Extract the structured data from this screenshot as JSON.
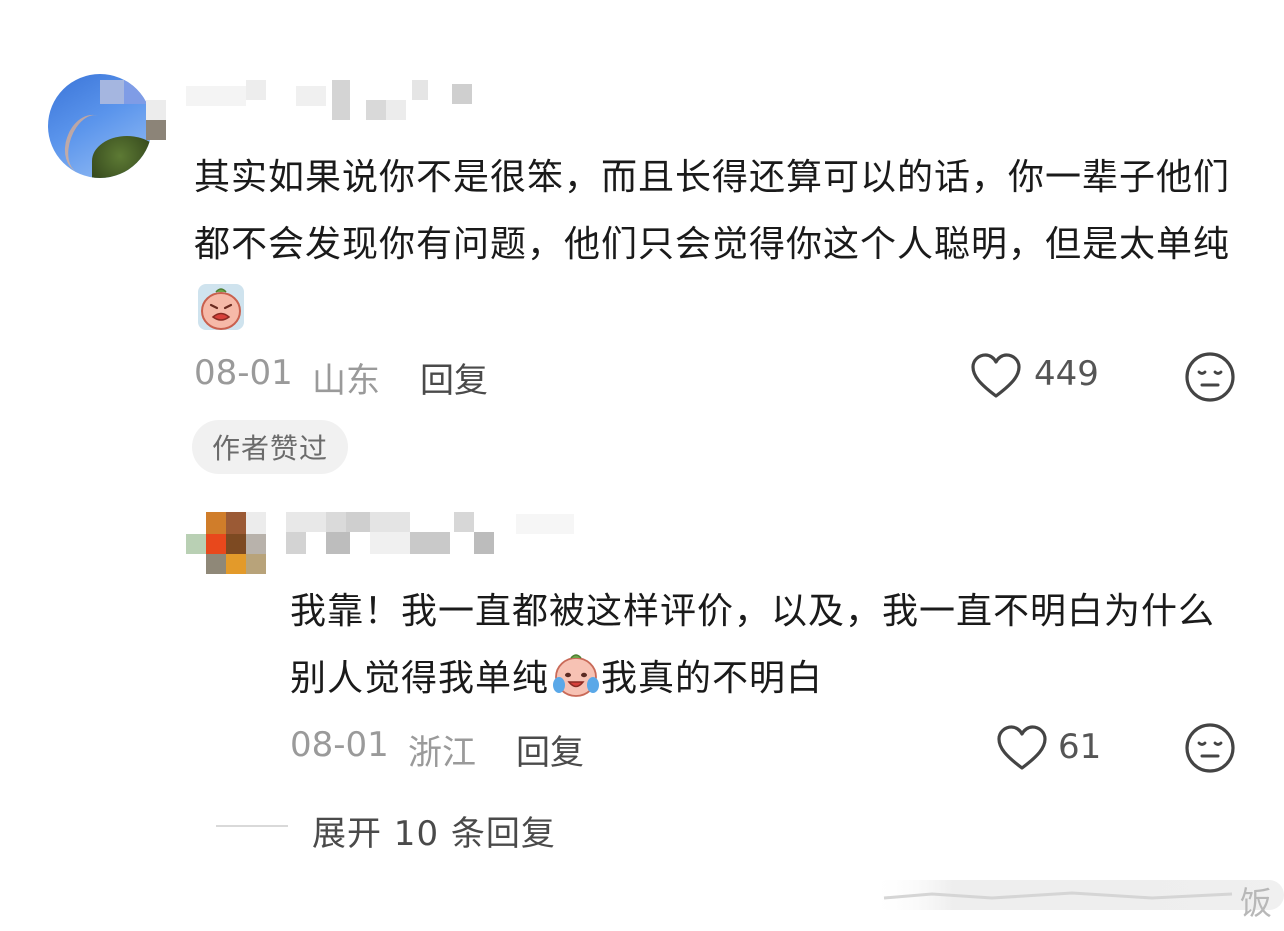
{
  "comment": {
    "text": "其实如果说你不是很笨，而且长得还算可以的话，你一辈子他们都不会发现你有问题，他们只会觉得你这个人聪明，但是太单纯",
    "emoji": "crying-face-emoji",
    "date": "08-01",
    "location": "山东",
    "reply_label": "回复",
    "likes": "449",
    "author_liked_badge": "作者赞过"
  },
  "reply": {
    "text_before_emoji": "我靠！我一直都被这样评价，以及，我一直不明白为什么别人觉得我单纯",
    "emoji": "tearful-laughing-face-emoji",
    "text_after_emoji": "我真的不明白",
    "date": "08-01",
    "location": "浙江",
    "reply_label": "回复",
    "likes": "61"
  },
  "expand_replies": "展开 10 条回复",
  "watermark_char": "饭",
  "icons": {
    "like": "heart-outline-icon",
    "dislike": "neutral-face-icon"
  },
  "colors": {
    "text": "#1a1a1a",
    "meta": "#9a9a9a",
    "badge_bg": "#f1f1f1"
  }
}
